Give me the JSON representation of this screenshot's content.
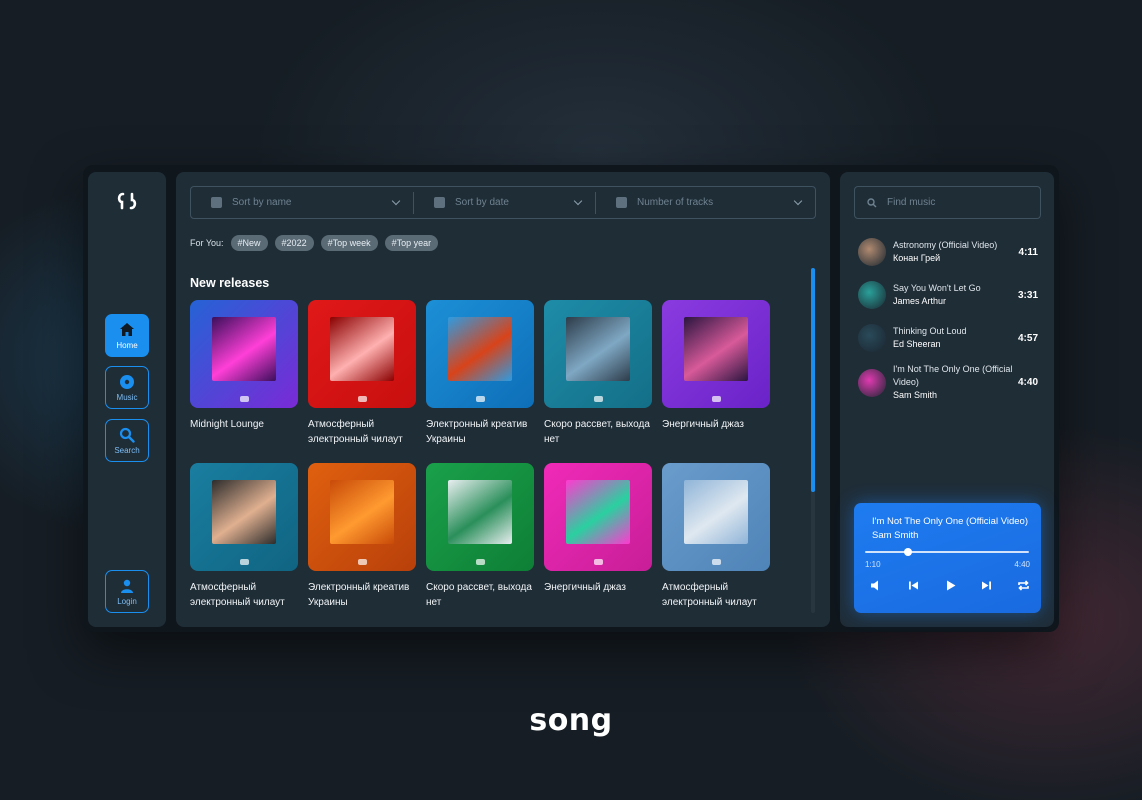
{
  "nav": {
    "items": [
      {
        "label": "Home",
        "icon": "home-icon",
        "active": true
      },
      {
        "label": "Music",
        "icon": "disc-icon",
        "active": false
      },
      {
        "label": "Search",
        "icon": "search-icon",
        "active": false
      }
    ],
    "login_label": "Login",
    "accent": "#1a8ff0"
  },
  "filters": {
    "sort_name": "Sort by name",
    "sort_date": "Sort by date",
    "tracks": "Number of tracks"
  },
  "for_you": {
    "label": "For You:",
    "tags": [
      "#New",
      "#2022",
      "#Top week",
      "#Top year"
    ]
  },
  "releases": {
    "title": "New releases",
    "cards": [
      {
        "title": "Midnight Lounge",
        "colors": [
          "#2563d6",
          "#7a2ad6"
        ],
        "art": [
          "#3a0f5c",
          "#ff3fd8"
        ]
      },
      {
        "title": "Атмосферный электронный чилаут",
        "colors": [
          "#e01818",
          "#c80f0f"
        ],
        "art": [
          "#8b0000",
          "#ffb0b0"
        ]
      },
      {
        "title": "Электронный креатив Украины",
        "colors": [
          "#1c8fd6",
          "#0e6fb8"
        ],
        "art": [
          "#2f9be0",
          "#d8431a"
        ]
      },
      {
        "title": "Скоро рассвет, выхода нет",
        "colors": [
          "#1e8ca8",
          "#146f88"
        ],
        "art": [
          "#2d3c4a",
          "#7fa8c4"
        ]
      },
      {
        "title": "Энергичный джаз",
        "colors": [
          "#8a3be0",
          "#6a23c8"
        ],
        "art": [
          "#2a1540",
          "#d85a9a"
        ]
      },
      {
        "title": "Атмосферный электронный чилаут",
        "colors": [
          "#1a7ea0",
          "#106482"
        ],
        "art": [
          "#2c2c2c",
          "#e0b090"
        ]
      },
      {
        "title": "Электронный креатив Украины",
        "colors": [
          "#e0600f",
          "#b8400a"
        ],
        "art": [
          "#c84a08",
          "#ff9a30"
        ]
      },
      {
        "title": "Скоро рассвет, выхода нет",
        "colors": [
          "#1aa04a",
          "#0e7f36"
        ],
        "art": [
          "#e8eef0",
          "#2a8f5a"
        ]
      },
      {
        "title": "Энергичный джаз",
        "colors": [
          "#f02ab8",
          "#c81e98"
        ],
        "art": [
          "#ff3ad0",
          "#2ad0a0"
        ]
      },
      {
        "title": "Атмосферный электронный чилаут",
        "colors": [
          "#6a9ccc",
          "#4f84b8"
        ],
        "art": [
          "#8fb4d8",
          "#dfe8f0"
        ]
      }
    ]
  },
  "search": {
    "placeholder": "Find music"
  },
  "playlist": [
    {
      "title": "Astronomy (Official Video)",
      "artist": "Конан Грей",
      "duration": "4:11",
      "color": "#b08a70"
    },
    {
      "title": "Say You Won't Let Go",
      "artist": "James Arthur",
      "duration": "3:31",
      "color": "#2aa09a"
    },
    {
      "title": "Thinking Out Loud",
      "artist": "Ed Sheeran",
      "duration": "4:57",
      "color": "#2a4a5a"
    },
    {
      "title": "I'm Not The Only One (Official Video)",
      "artist": "Sam Smith",
      "duration": "4:40",
      "color": "#e03ab0"
    }
  ],
  "player": {
    "title": "I'm Not The Only One (Official Video)",
    "artist": "Sam Smith",
    "current": "1:10",
    "total": "4:40",
    "progress": 0.26
  },
  "brand": "song"
}
